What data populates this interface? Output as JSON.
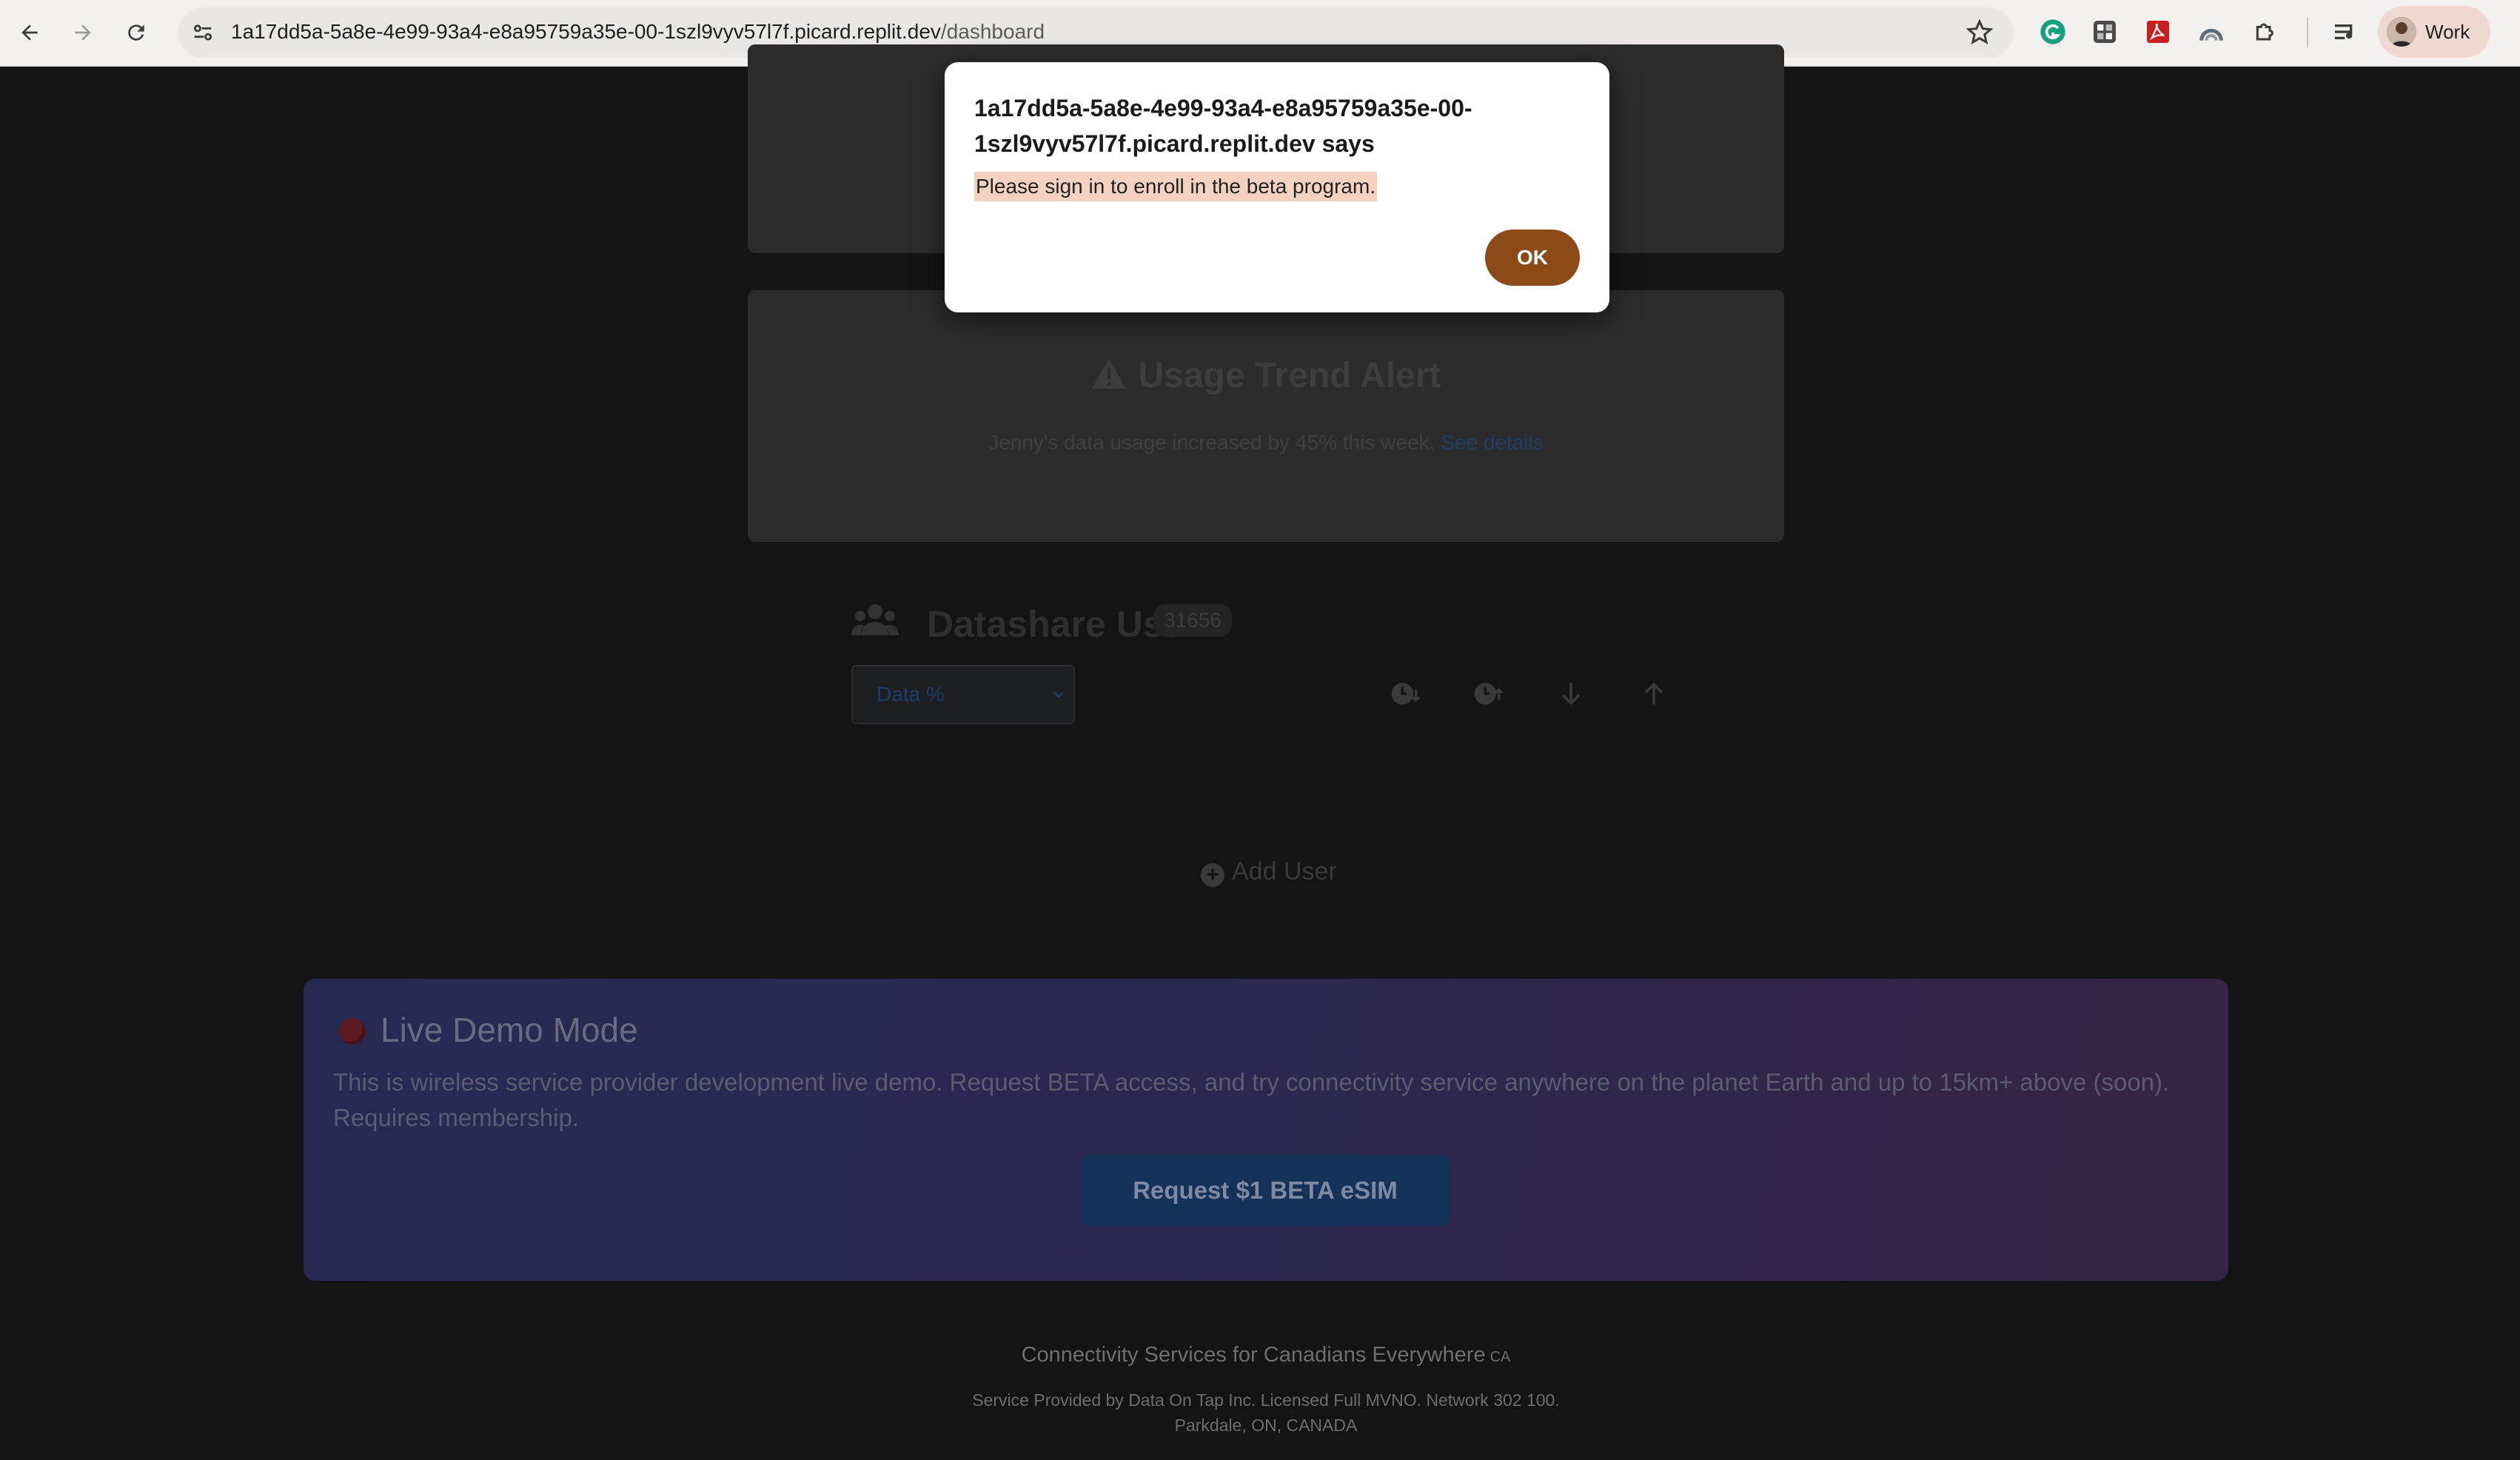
{
  "browser": {
    "url_host": "1a17dd5a-5a8e-4e99-93a4-e8a95759a35e-00-1szl9vyv57l7f.picard.replit.dev",
    "url_path": "/dashboard",
    "profile_label": "Work",
    "extensions": [
      "grammarly-icon",
      "ext-grid-icon",
      "pdf-icon",
      "arc-icon",
      "puzzle-icon"
    ]
  },
  "dialog": {
    "title": "1a17dd5a-5a8e-4e99-93a4-e8a95759a35e-00-1szl9vyv57l7f.picard.replit.dev says",
    "message": "Please sign in to enroll in the beta program.",
    "ok_label": "OK"
  },
  "alert_card": {
    "title": "Usage Trend Alert",
    "text": "Jenny's data usage increased by 45% this week.",
    "link": "See details"
  },
  "datashare": {
    "title": "Datashare Users",
    "count": "31656",
    "sort_select": "Data %",
    "add_user_label": "Add User"
  },
  "demo": {
    "title": "Live Demo Mode",
    "text": "This is wireless service provider development live demo. Request BETA access, and try connectivity service anywhere on the planet Earth and up to 15km+ above (soon). Requires membership.",
    "button_label": "Request $1 BETA eSIM"
  },
  "footer": {
    "tagline": "Connectivity Services for Canadians Everywhere",
    "country_code": "CA",
    "line1": "Service Provided by Data On Tap Inc. Licensed Full MVNO. Network 302 100.",
    "line2": "Parkdale, ON, CANADA"
  }
}
